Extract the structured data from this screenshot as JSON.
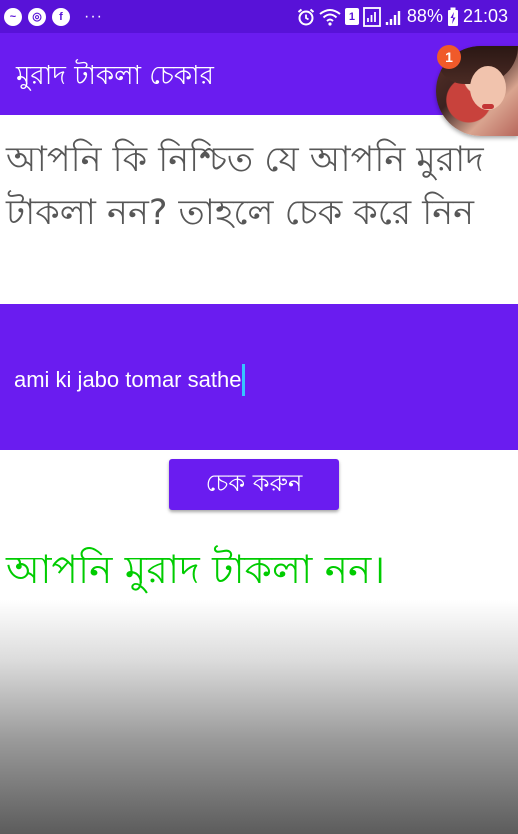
{
  "status_bar": {
    "icons": [
      "messenger-icon",
      "wheel-icon",
      "facebook-icon",
      "more-icon",
      "alarm-icon",
      "wifi-icon",
      "sim-1-icon",
      "sim-icon",
      "signal-icon",
      "battery-icon"
    ],
    "more": "···",
    "sim_label": "1",
    "battery": "88%",
    "time": "21:03"
  },
  "app_bar": {
    "title": "মুরাদ টাকলা চেকার",
    "notification_count": "1"
  },
  "question": {
    "text": "আপনি কি নিশ্চিত যে আপনি মুরাদ টাকলা নন? তাহলে চেক করে নিন"
  },
  "input": {
    "value": "ami ki jabo tomar sathe"
  },
  "button": {
    "label": "চেক করুন"
  },
  "result": {
    "text": "আপনি মুরাদ টাকলা নন।"
  },
  "colors": {
    "status_bar": "#5812d8",
    "primary": "#6a1cf0",
    "question_text": "#575757",
    "result_text": "#00cc00",
    "caret": "#36c4ff"
  }
}
